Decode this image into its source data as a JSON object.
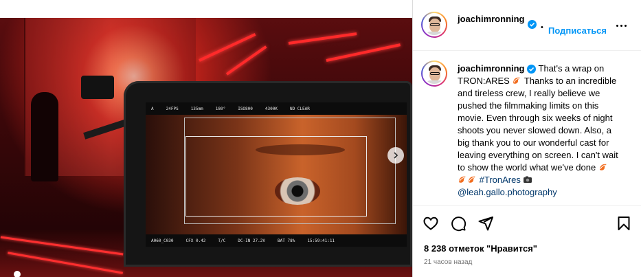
{
  "post": {
    "username": "joachimronning",
    "follow_label": "Подписаться",
    "dot": "•",
    "caption_user": "joachimronning",
    "caption_line_1": " That's a wrap on TRON:ARES ",
    "caption_line_2": " Thanks to an incredible and tireless crew, I really believe we pushed the filmmaking limits on this movie. Even through six weeks of night shoots you never slowed down. Also, a big thank you to our wonderful cast for leaving everything on screen. I can't wait to show the world what we've done ",
    "hashtag": "#TronAres",
    "mention": "@leah.gallo.photography",
    "likes_text": "8 238 отметок \"Нравится\"",
    "time_text": "21 часов назад"
  },
  "monitor": {
    "top_readout": [
      "A",
      "24FPS",
      "135mm",
      "180°",
      "ISO800",
      "4300K",
      "ND CLEAR"
    ],
    "bottom_readout": [
      "A060_C030",
      "CFX 0.42",
      "T/C",
      "DC-IN 27.2V",
      "BAT 78%",
      "15:59:41:11"
    ]
  },
  "colors": {
    "follow_blue": "#0095f6",
    "verified_blue": "#0095f6",
    "secondary_text": "#737373",
    "link_text": "#00376b"
  },
  "icons": [
    "verified-badge-icon",
    "more-options-icon",
    "like-heart-icon",
    "comment-icon",
    "share-icon",
    "save-bookmark-icon",
    "next-slide-chevron-icon",
    "orange-emoji-icon",
    "camera-emoji-icon"
  ]
}
